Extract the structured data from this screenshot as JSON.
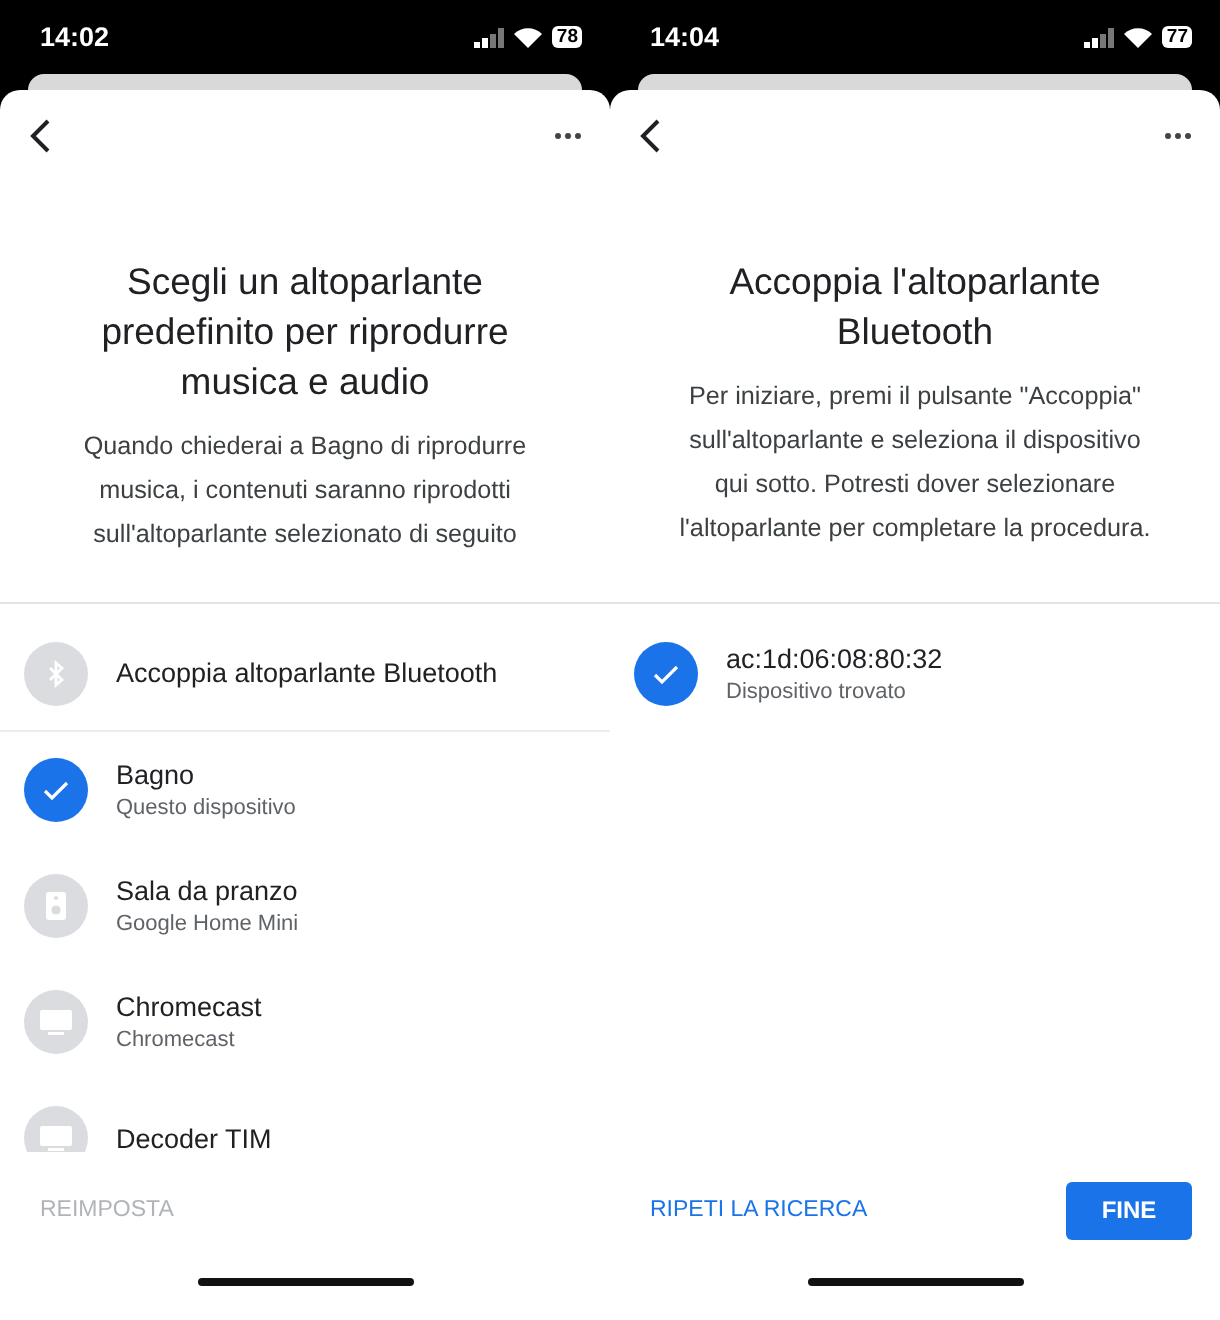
{
  "screens": [
    {
      "status_bar": {
        "time": "14:02",
        "battery": "78"
      },
      "title": "Scegli un altoparlante predefinito per riprodurre musica e audio",
      "description": "Quando chiederai a Bagno di riprodurre musica, i contenuti saranno riprodotti sull'altoparlante selezionato di seguito",
      "list": [
        {
          "kind": "action",
          "name": "Accoppia altoparlante Bluetooth"
        },
        {
          "kind": "speaker",
          "name": "Bagno",
          "subtitle": "Questo dispositivo",
          "selected": true
        },
        {
          "kind": "speaker",
          "name": "Sala da pranzo",
          "subtitle": "Google Home Mini",
          "selected": false
        },
        {
          "kind": "tv",
          "name": "Chromecast",
          "subtitle": "Chromecast",
          "selected": false
        },
        {
          "kind": "tv",
          "name": "Decoder TIM",
          "selected": false
        }
      ],
      "buttons": [
        {
          "kind": "text",
          "label": "REIMPOSTA",
          "disabled": true
        }
      ]
    },
    {
      "status_bar": {
        "time": "14:04",
        "battery": "77"
      },
      "title": "Accoppia l'altoparlante Bluetooth",
      "description": "Per iniziare, premi il pulsante \"Accoppia\" sull'altoparlante e seleziona il dispositivo qui sotto. Potresti dover selezionare l'altoparlante per completare la procedura.",
      "list": [
        {
          "kind": "speaker",
          "name": "ac:1d:06:08:80:32",
          "subtitle": "Dispositivo trovato",
          "selected": true
        }
      ],
      "buttons": [
        {
          "kind": "text",
          "label": "RIPETI LA RICERCA",
          "disabled": false
        },
        {
          "kind": "filled",
          "label": "FINE",
          "disabled": false
        }
      ]
    }
  ]
}
